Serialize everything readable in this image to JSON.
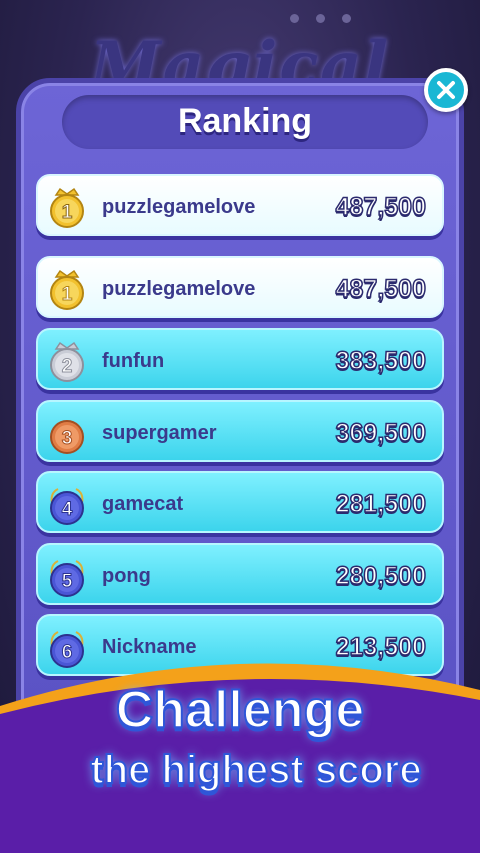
{
  "colors": {
    "panel": "#6d65d6",
    "row_me": "#ffffff",
    "row_other": "#3cd4ec",
    "gold": "#f2c12e",
    "silver": "#c9ccd6",
    "bronze": "#e07c45",
    "blue_medal": "#4a56d6",
    "banner_purple": "#5a1ea8",
    "banner_orange": "#f4a11a",
    "close_button": "#19b7d4"
  },
  "panel": {
    "title": "Ranking",
    "close_icon": "close-icon"
  },
  "my_rank": {
    "rank": "1",
    "name": "puzzlegamelove",
    "score": "487,500",
    "medal": "gold"
  },
  "rankings": [
    {
      "rank": "1",
      "name": "puzzlegamelove",
      "score": "487,500",
      "medal": "gold",
      "highlight": true
    },
    {
      "rank": "2",
      "name": "funfun",
      "score": "383,500",
      "medal": "silver",
      "highlight": false
    },
    {
      "rank": "3",
      "name": "supergamer",
      "score": "369,500",
      "medal": "bronze",
      "highlight": false
    },
    {
      "rank": "4",
      "name": "gamecat",
      "score": "281,500",
      "medal": "blue",
      "highlight": false
    },
    {
      "rank": "5",
      "name": "pong",
      "score": "280,500",
      "medal": "blue",
      "highlight": false
    },
    {
      "rank": "6",
      "name": "Nickname",
      "score": "213,500",
      "medal": "blue",
      "highlight": false
    }
  ],
  "banner": {
    "line1": "Challenge",
    "line2": "the highest score"
  }
}
